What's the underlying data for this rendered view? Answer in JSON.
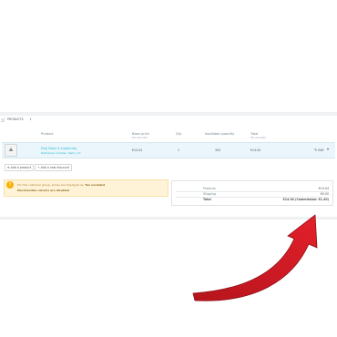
{
  "panel": {
    "cart_icon": "shopping-cart-icon",
    "title": "PRODUCTS",
    "count": "1"
  },
  "table": {
    "headers": {
      "product": "Product",
      "base_price": "Base price",
      "base_price_sub": "Tax excluded",
      "qty": "Qty",
      "available": "Available quantity",
      "total": "Total",
      "total_sub": "Tax excluded"
    },
    "row": {
      "thumb_icon": "image-placeholder-icon",
      "name": "Mug Today is a good day",
      "reference": "Reference number: demo_13",
      "base_price": "€14.04",
      "qty": "1",
      "available": "300",
      "total": "€14.04",
      "edit_label": "Edit",
      "edit_icon": "pencil-icon",
      "more_icon": "chevron-down-icon"
    }
  },
  "actions": {
    "add_product": "Add a product",
    "add_discount": "Add a new discount"
  },
  "notice": {
    "icon": "warning-icon",
    "line1_prefix": "For this customer group, prices are displayed as:",
    "line1_strong": "Tax excluded",
    "line2": "Merchandise returns are disabled"
  },
  "totals": {
    "products_label": "Products",
    "products_value": "€14.04",
    "shipping_label": "Shipping",
    "shipping_value": "€0.00",
    "total_label": "Total",
    "total_value": "€14.04 (Commission: €1.40)"
  },
  "colors": {
    "accent": "#25b9d7",
    "arrow": "#e3202a",
    "warning": "#fab000"
  }
}
